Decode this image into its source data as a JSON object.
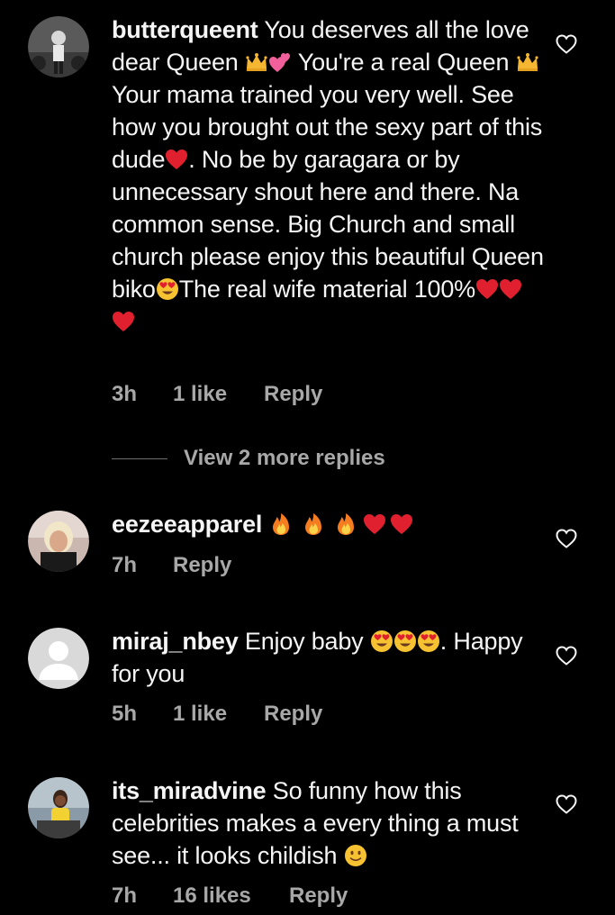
{
  "comments": [
    {
      "username": "butterqueent",
      "segments": [
        "You deserves all the love dear Queen ",
        " You're a real Queen ",
        " Your mama trained you very well. See how you brought out the sexy part of this dude",
        ". No be by garagara or by unnecessary shout here and there. Na common sense. Big Church and small church please enjoy this beautiful Queen biko",
        "The real wife material 100%"
      ],
      "time": "3h",
      "likes": "1 like",
      "reply": "Reply"
    },
    {
      "username": "eezeeapparel",
      "time": "7h",
      "reply": "Reply"
    },
    {
      "username": "miraj_nbey",
      "segments": [
        "Enjoy baby ",
        ". Happy for you"
      ],
      "time": "5h",
      "likes": "1 like",
      "reply": "Reply"
    },
    {
      "username": "its_miradvine",
      "segments": [
        "So funny how this celebrities makes a every thing a must see... it looks childish "
      ],
      "time": "7h",
      "likes": "16 likes",
      "reply": "Reply"
    }
  ],
  "view_more_replies": "View 2 more replies",
  "icons": {
    "heart_outline": "heart-outline-icon",
    "crown": "crown-emoji",
    "two_hearts": "two-hearts-emoji",
    "red_heart": "red-heart-emoji",
    "heart_eyes": "heart-eyes-emoji",
    "fire": "fire-emoji",
    "slight_smile": "slightly-smiling-emoji"
  },
  "colors": {
    "background": "#000000",
    "text": "#f5f5f5",
    "meta": "#a8a8a8"
  }
}
